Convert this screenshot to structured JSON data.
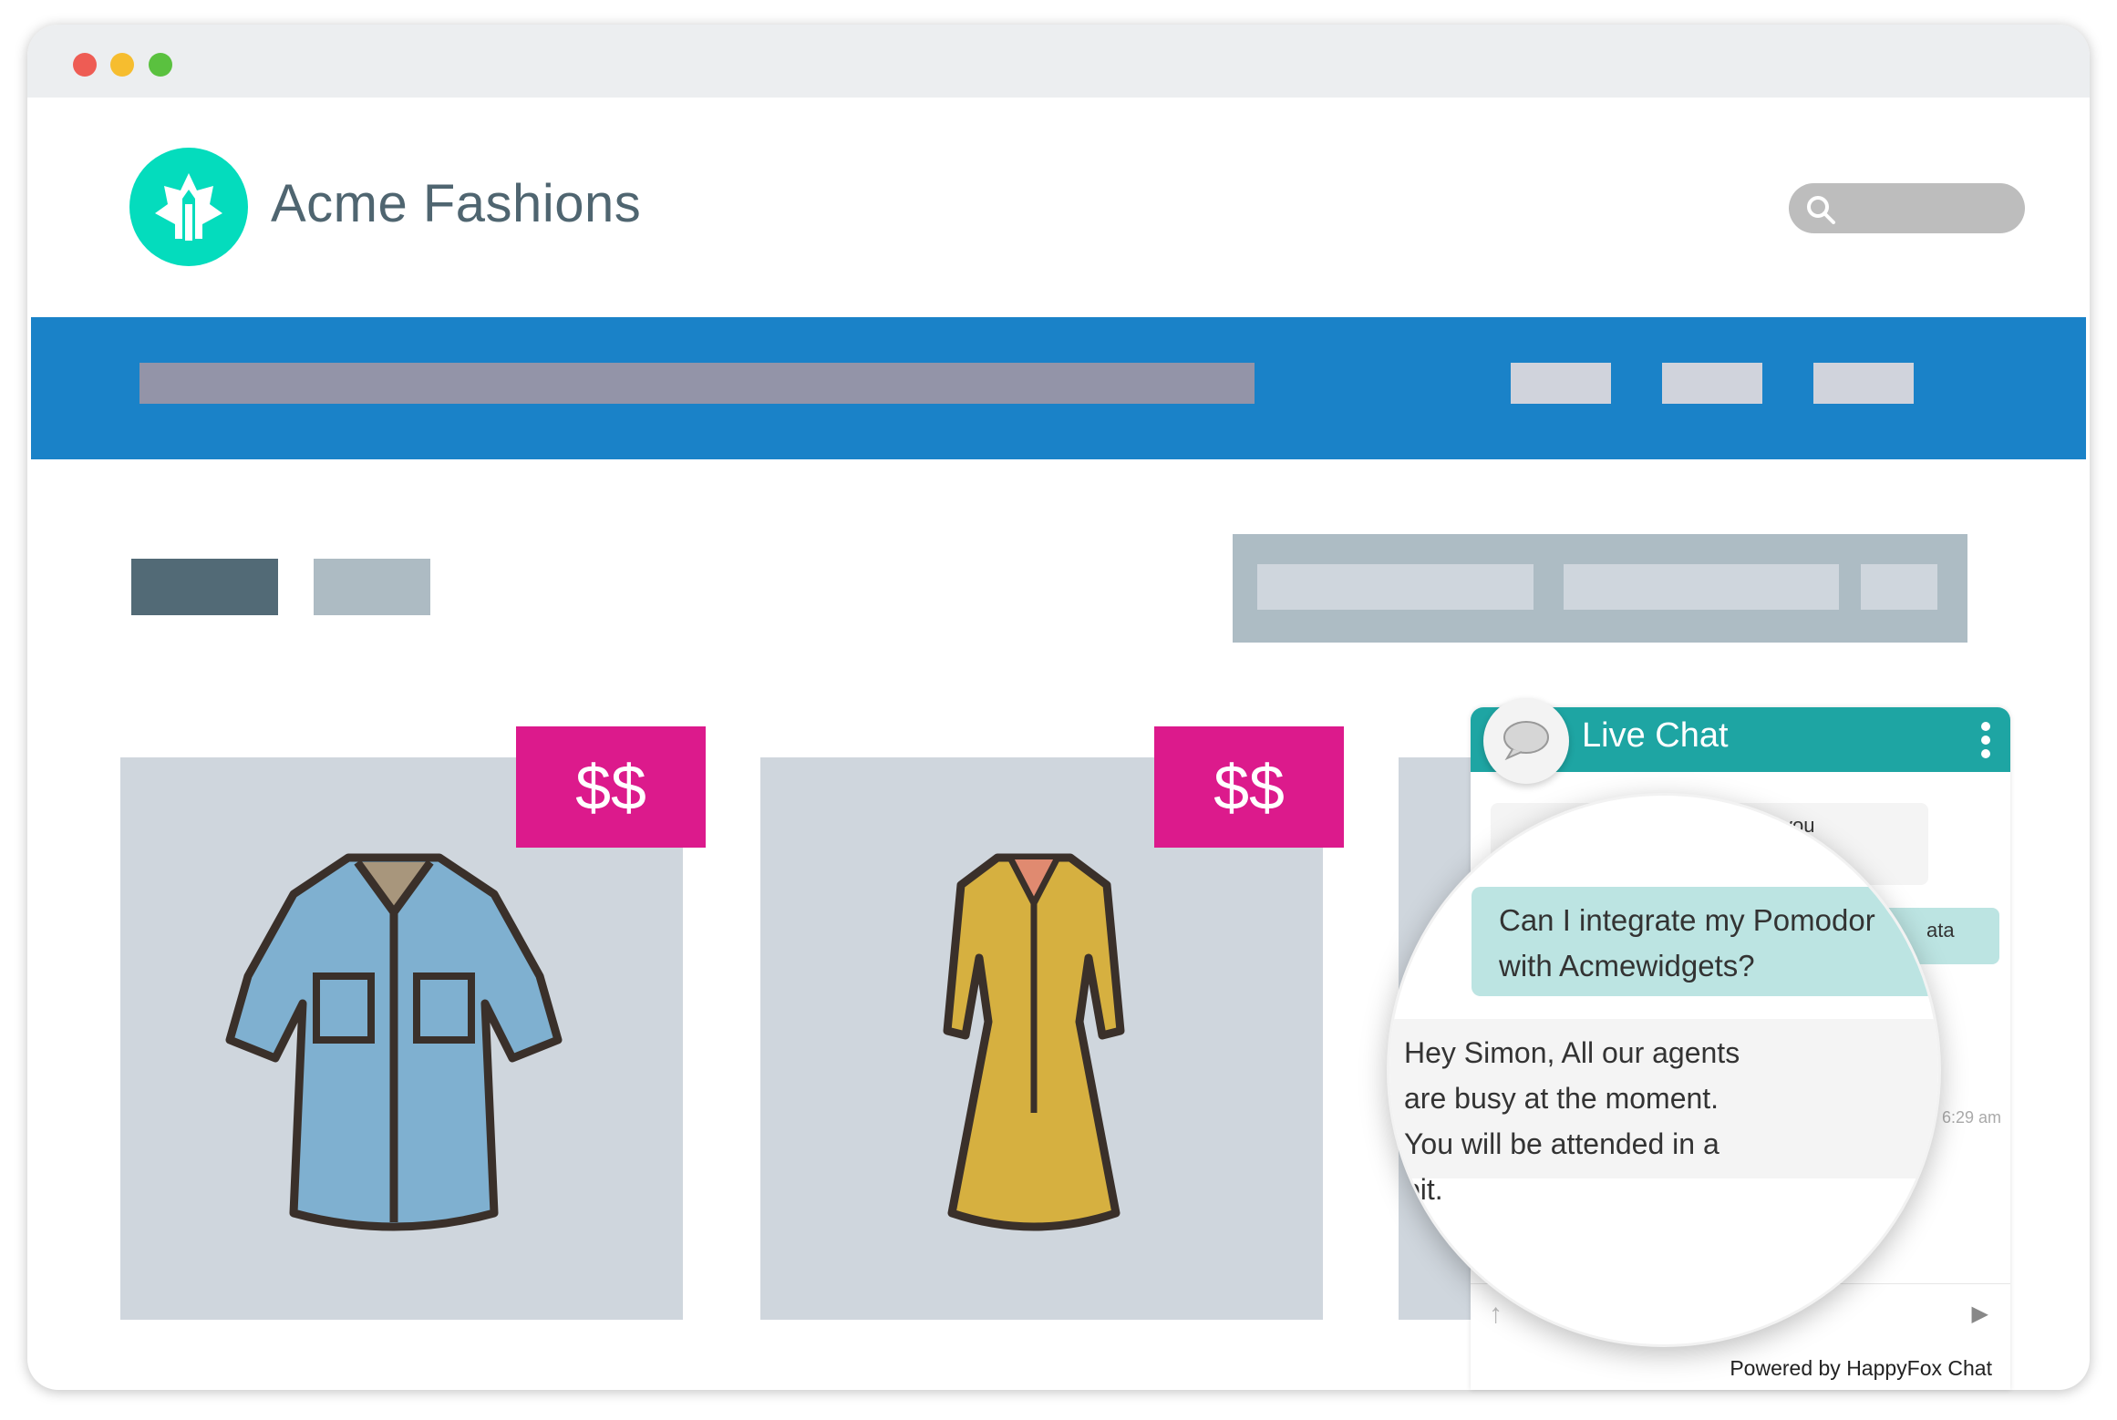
{
  "window": {
    "controls": [
      "close",
      "minimize",
      "maximize"
    ],
    "colors": {
      "close": "#ee5c54",
      "minimize": "#f6bd2f",
      "maximize": "#5ac13f"
    }
  },
  "header": {
    "brand": "Acme Fashions",
    "logo_icon": "maple-leaf-pen-logo",
    "search_icon": "search-icon"
  },
  "colors": {
    "nav": "#1a82c8",
    "price_tag": "#dc1a8c",
    "chat_header": "#1ea5a3",
    "logo": "#04dcbd"
  },
  "products": [
    {
      "price": "$$",
      "item": "denim-shirt"
    },
    {
      "price": "$$",
      "item": "yellow-dress"
    }
  ],
  "chat": {
    "title": "Live Chat",
    "partial_greeting_end": "you",
    "partial_user_end": "ata",
    "user_message": "Can I integrate my Pomodoro data with Acmewidgets?",
    "user_message_visible": "Can I integrate my Pomodor",
    "user_message_line2": "with Acmewidgets?",
    "agent_message": "Hey Simon, All our agents are busy at the moment. You will be attended in a bit.",
    "timestamp": "6:29 am",
    "powered_by": "Powered by HappyFox Chat"
  }
}
